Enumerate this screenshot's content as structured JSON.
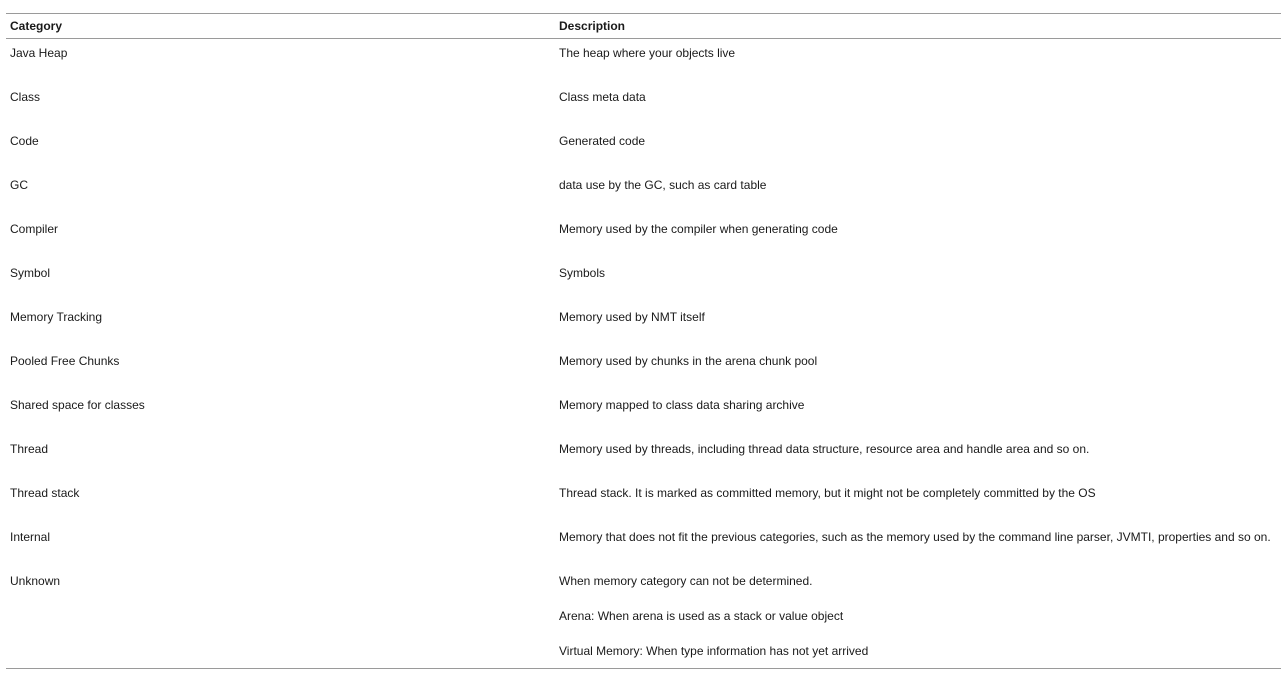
{
  "table": {
    "headers": {
      "category": "Category",
      "description": "Description"
    },
    "rows": [
      {
        "category": "Java Heap",
        "description": [
          "The heap where your objects live"
        ]
      },
      {
        "category": "Class",
        "description": [
          "Class meta data"
        ]
      },
      {
        "category": "Code",
        "description": [
          "Generated code"
        ]
      },
      {
        "category": "GC",
        "description": [
          "data use by the GC, such as card table"
        ]
      },
      {
        "category": "Compiler",
        "description": [
          "Memory used by the compiler when generating code"
        ]
      },
      {
        "category": "Symbol",
        "description": [
          "Symbols"
        ]
      },
      {
        "category": "Memory Tracking",
        "description": [
          "Memory used by NMT itself"
        ]
      },
      {
        "category": "Pooled Free Chunks",
        "description": [
          "Memory used by chunks in the arena chunk pool"
        ]
      },
      {
        "category": "Shared space for classes",
        "description": [
          "Memory mapped to class data sharing archive"
        ]
      },
      {
        "category": "Thread",
        "description": [
          "Memory used by threads, including thread data structure, resource area and handle area and so on."
        ]
      },
      {
        "category": "Thread stack",
        "description": [
          "Thread stack. It is marked as committed memory, but it might not be completely committed by the OS"
        ]
      },
      {
        "category": "Internal",
        "description": [
          "Memory that does not fit the previous categories, such as the memory used by the command line parser, JVMTI, properties and so on."
        ]
      },
      {
        "category": "Unknown",
        "description": [
          "When memory category can not be determined.",
          "Arena: When arena is used as a stack or value object",
          "Virtual Memory: When type information has not yet arrived"
        ]
      }
    ]
  }
}
